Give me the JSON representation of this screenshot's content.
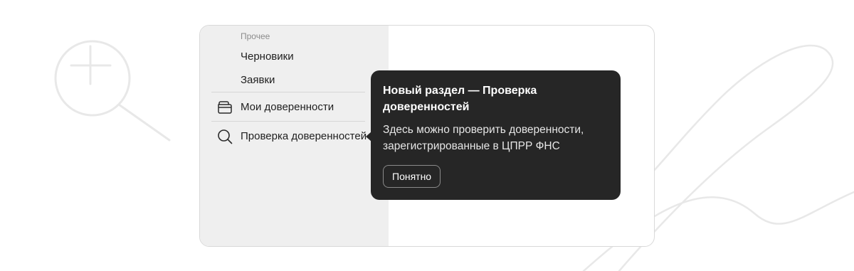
{
  "sidebar": {
    "section_caption": "Прочее",
    "items": [
      {
        "label": "Черновики",
        "icon": null
      },
      {
        "label": "Заявки",
        "icon": null
      },
      {
        "label": "Мои доверенности",
        "icon": "wallet-icon"
      },
      {
        "label": "Проверка доверенностей",
        "icon": "search-icon"
      }
    ]
  },
  "tooltip": {
    "title": "Новый раздел — Проверка доверенностей",
    "body": "Здесь можно проверить доверенности, зарегистрированные в ЦПРР ФНС",
    "button_label": "Понятно"
  },
  "decoration": {
    "icon": "zoom-in-icon"
  },
  "colors": {
    "tooltip_background": "#262626",
    "sidebar_background": "#efefef",
    "decoration_stroke": "#e8e8e8"
  }
}
